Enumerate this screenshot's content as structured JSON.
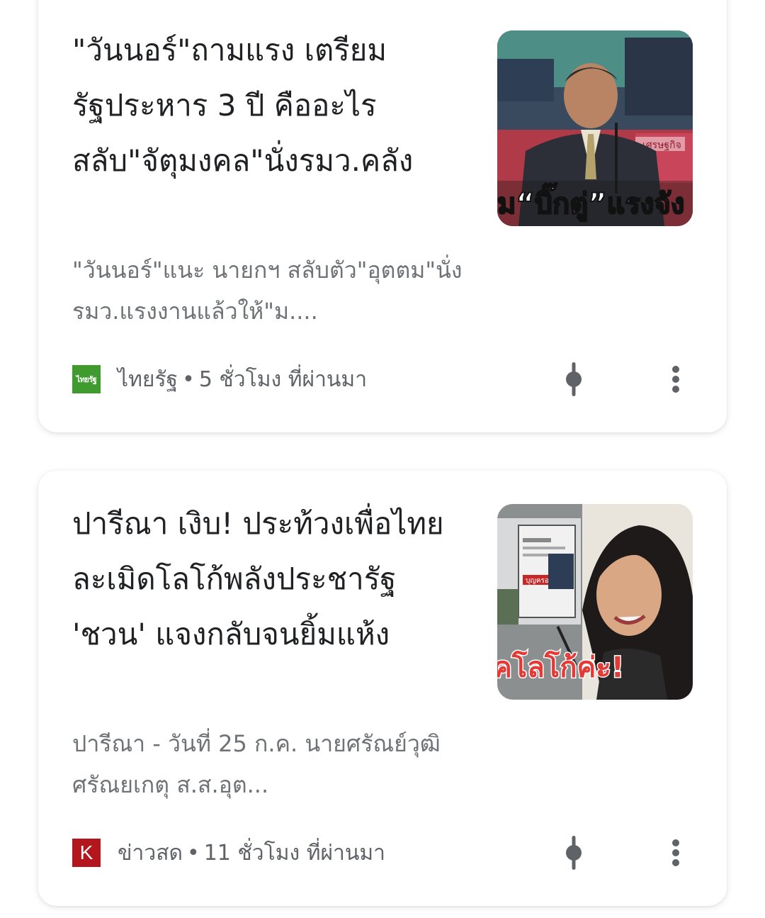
{
  "articles": [
    {
      "headline": "\"วันนอร์\"ถามแรง เตรียมรัฐประหาร 3 ปี คืออะไร สลับ\"จัตุมงคล\"นั่งรมว.คลัง",
      "snippet": "\"วันนอร์\"แนะ นายกฯ สลับตัว\"อุตตม\"นั่งรมว.แรงงานแล้วให้\"ม....",
      "source": "ไทยรัฐ",
      "source_logo_text": "ไทยรัฐ",
      "time": "5 ชั่วโมง ที่ผ่านมา",
      "separator": "•",
      "thumbnail_caption": "ม“บิ๊กตู่”แรงจัง",
      "thumbnail_tag": "เศรษฐกิจ",
      "follow_icon": "follow-pin-icon",
      "more_icon": "more-vert-icon",
      "logo_color": "#3f9b2e"
    },
    {
      "headline": "ปารีณา เงิบ! ประท้วงเพื่อไทย ละเมิดโลโก้พลังประชารัฐ 'ชวน' แจงกลับจนยิ้มแห้ง",
      "snippet": "ปารีณา - วันที่ 25 ก.ค. นายศรัณย์วุฒิ ศรัณยเกตุ ส.ส.อุต...",
      "source": "ข่าวสด",
      "source_logo_text": "K",
      "time": "11 ชั่วโมง ที่ผ่านมา",
      "separator": "•",
      "thumbnail_caption": "คโลโก้ค่ะ!",
      "thumbnail_tag": "บุญครอง",
      "follow_icon": "follow-pin-icon",
      "more_icon": "more-vert-icon",
      "logo_color": "#b3161c"
    }
  ]
}
